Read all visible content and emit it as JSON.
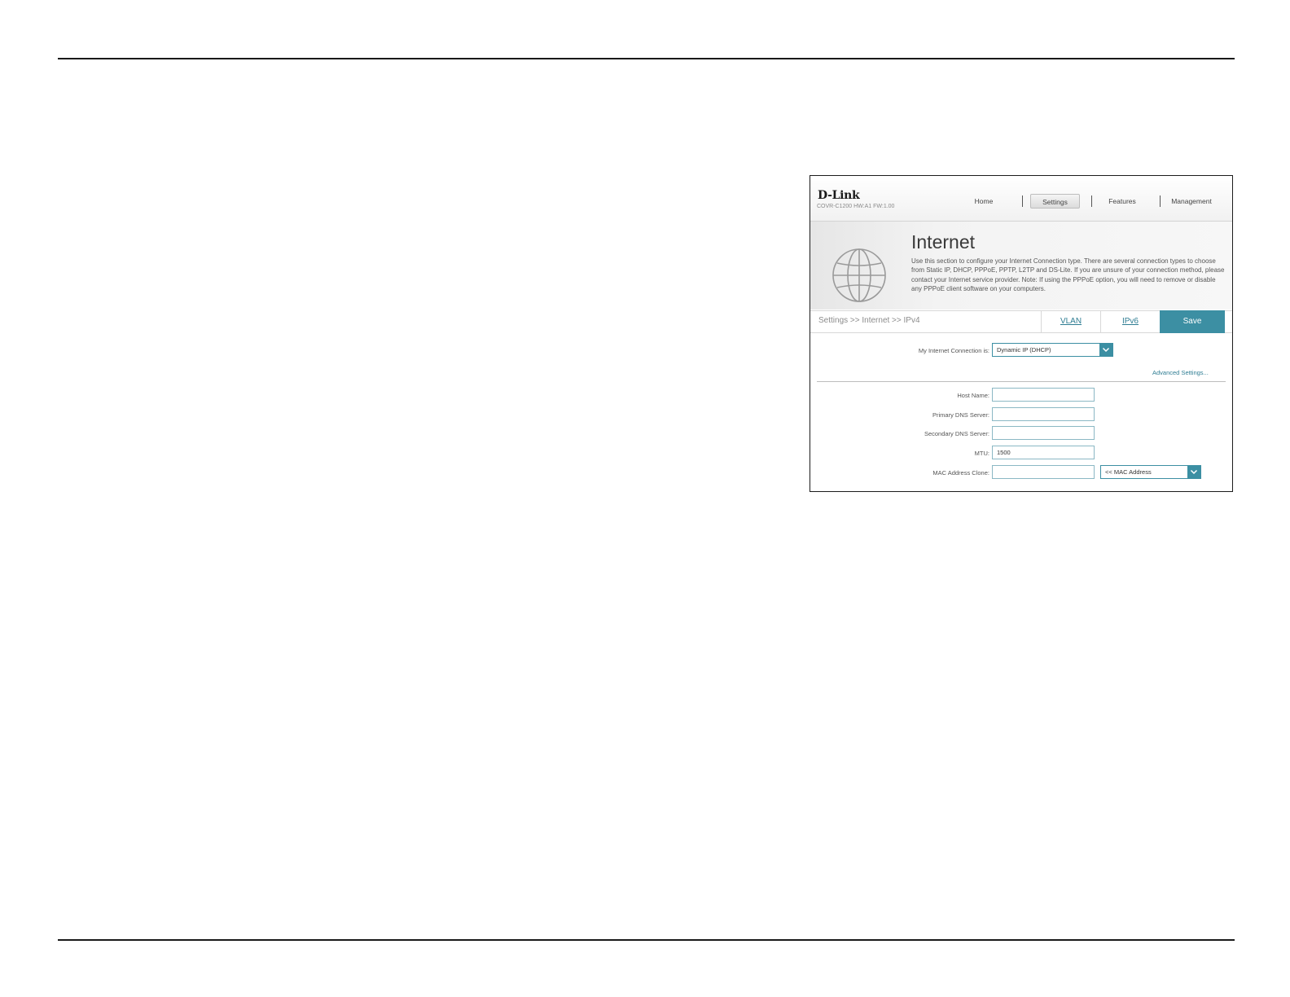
{
  "router_ui": {
    "brand": "D-Link",
    "model_info": "COVR-C1200 HW:A1 FW:1.00",
    "nav": {
      "home": "Home",
      "settings": "Settings",
      "features": "Features",
      "management": "Management",
      "active": "Settings"
    },
    "page_title": "Internet",
    "description": "Use this section to configure your Internet Connection type. There are several connection types to choose from Static IP, DHCP, PPPoE, PPTP, L2TP and DS-Lite. If you are unsure of your connection method, please contact your Internet service provider. Note: If using the PPPoE option, you will need to remove or disable any PPPoE client software on your computers.",
    "breadcrumb": "Settings >> Internet >> IPv4",
    "tabs": {
      "vlan": "VLAN",
      "ipv6": "IPv6"
    },
    "save_label": "Save",
    "connection": {
      "label": "My Internet Connection is:",
      "value": "Dynamic IP (DHCP)"
    },
    "advanced_link": "Advanced Settings...",
    "fields": {
      "host_name": {
        "label": "Host Name:",
        "value": ""
      },
      "primary_dns": {
        "label": "Primary DNS Server:",
        "value": ""
      },
      "secondary_dns": {
        "label": "Secondary DNS Server:",
        "value": ""
      },
      "mtu": {
        "label": "MTU:",
        "value": "1500"
      },
      "mac_clone": {
        "label": "MAC Address Clone:",
        "value": "",
        "select_value": "<< MAC Address"
      }
    },
    "colors": {
      "accent": "#3c8fa3",
      "link": "#2f7d93"
    },
    "icons": [
      "globe-icon",
      "chevron-down-icon"
    ]
  }
}
